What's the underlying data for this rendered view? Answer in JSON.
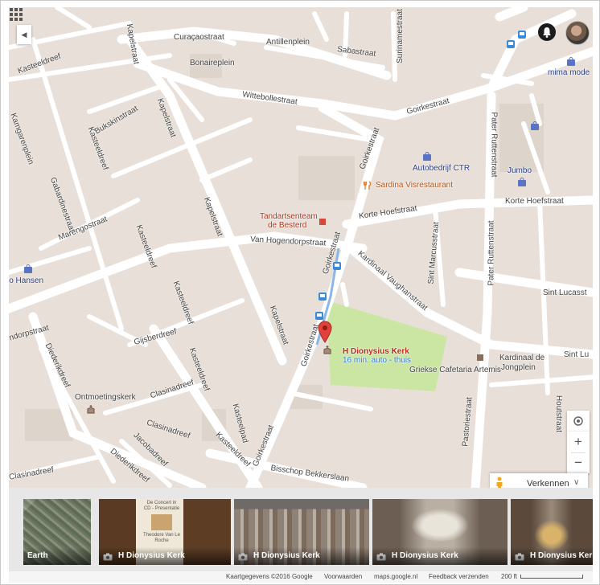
{
  "colors": {
    "map_bg": "#e8e0d8",
    "road": "#ffffff",
    "park": "#cbe6a3",
    "pin": "#e2403a",
    "transit": "#3b8ad8",
    "shop": "#3350a0"
  },
  "streets": [
    {
      "id": "curacaostraat",
      "text": "Curaçaostraat"
    },
    {
      "id": "antillenplein",
      "text": "Antillenplein"
    },
    {
      "id": "sabastraat",
      "text": "Sabastraat"
    },
    {
      "id": "surinamestraat",
      "text": "Surinamestraat"
    },
    {
      "id": "bonaireplein",
      "text": "Bonaireplein"
    },
    {
      "id": "kapelstraat-top",
      "text": "Kapelstraat"
    },
    {
      "id": "kasteeldreef-top",
      "text": "Kasteeldreef"
    },
    {
      "id": "wittebollestraat",
      "text": "Wittebollestraat"
    },
    {
      "id": "goirkestraat-ne",
      "text": "Goirkestraat"
    },
    {
      "id": "bukskinstraat",
      "text": "Bukskinstraat"
    },
    {
      "id": "kapelstraat-mid",
      "text": "Kapelstraat"
    },
    {
      "id": "kamgarenplein",
      "text": "Kamgarenplein"
    },
    {
      "id": "kasteeldreef-2",
      "text": "Kasteeldreef"
    },
    {
      "id": "gabardinestraat",
      "text": "Gabardinestraat"
    },
    {
      "id": "pater-ruttenstraat-top",
      "text": "Pater Ruttenstraat"
    },
    {
      "id": "goirkestraat-mid",
      "text": "Goirkestraat"
    },
    {
      "id": "kapelstraat-3",
      "text": "Kapelstraat"
    },
    {
      "id": "korte-hoefstraat-1",
      "text": "Korte Hoefstraat"
    },
    {
      "id": "korte-hoefstraat-2",
      "text": "Korte Hoefstraat"
    },
    {
      "id": "marengostraat",
      "text": "Marengostraat"
    },
    {
      "id": "kasteeldreef-3",
      "text": "Kasteeldreef"
    },
    {
      "id": "van-hogendorpstraat",
      "text": "Van Hogendorpstraat"
    },
    {
      "id": "goirkestraat-3",
      "text": "Goirkestraat"
    },
    {
      "id": "sint-marcusstraat",
      "text": "Sint Marcusstraat"
    },
    {
      "id": "pater-ruttenstraat-2",
      "text": "Pater Ruttenstraat"
    },
    {
      "id": "kardinaal-vaughanstraat",
      "text": "Kardinaal Vaughanstraat"
    },
    {
      "id": "sint-lucasstraat",
      "text": "Sint Lucasst"
    },
    {
      "id": "kasteeldreef-4",
      "text": "Kasteeldreef"
    },
    {
      "id": "kapelstraat-4",
      "text": "Kapelstraat"
    },
    {
      "id": "ndorpstraat",
      "text": "ndorpstraat"
    },
    {
      "id": "gijsberdreef",
      "text": "Gijsberdreef"
    },
    {
      "id": "diederikdreef-1",
      "text": "Diederikdreef"
    },
    {
      "id": "goirkestraat-4",
      "text": "Goirkestraat"
    },
    {
      "id": "kardinaal-de-jongplein-1",
      "text": "Kardinaal de"
    },
    {
      "id": "kardinaal-de-jongplein-2",
      "text": "Jongplein"
    },
    {
      "id": "sint-lu-2",
      "text": "Sint Lu"
    },
    {
      "id": "clasinadreef-1",
      "text": "Clasinadreef"
    },
    {
      "id": "kasteeldreef-5",
      "text": "Kasteeldreef"
    },
    {
      "id": "clasinadreef-2",
      "text": "Clasinadreef"
    },
    {
      "id": "kasteelpad",
      "text": "Kasteelpad"
    },
    {
      "id": "jacobadreef",
      "text": "Jacobadreef"
    },
    {
      "id": "kasteeldreef-6",
      "text": "Kasteeldreef"
    },
    {
      "id": "clasinadreef-3",
      "text": "Clasinadreef"
    },
    {
      "id": "diederikdreef-2",
      "text": "Diederikdreef"
    },
    {
      "id": "goirkestraat-5",
      "text": "Goirkestraat"
    },
    {
      "id": "bisschop-bekkerslaan",
      "text": "Bisschop Bekkerslaan"
    },
    {
      "id": "pastoriestraat",
      "text": "Pastoriestraat"
    },
    {
      "id": "houtstraat",
      "text": "Houtstraat"
    }
  ],
  "pois": [
    {
      "id": "mima-mode",
      "text": "mima mode",
      "kind": "shop"
    },
    {
      "id": "autobedrijf-ctr",
      "text": "Autobedrijf CTR",
      "kind": "shop"
    },
    {
      "id": "jumbo",
      "text": "Jumbo",
      "kind": "shop"
    },
    {
      "id": "sardina",
      "text": "Sardina Visrestaurant",
      "kind": "food"
    },
    {
      "id": "tandarts-1",
      "text": "Tandartsenteam",
      "kind": "dent"
    },
    {
      "id": "tandarts-2",
      "text": "de Besterd",
      "kind": "dent"
    },
    {
      "id": "hansen",
      "text": "lo Hansen",
      "kind": "shop"
    },
    {
      "id": "cafetaria",
      "text": "Griekse Cafetaria Artemis",
      "kind": "gen"
    },
    {
      "id": "ontmoetingskerk",
      "text": "Ontmoetingskerk",
      "kind": "gen"
    }
  ],
  "pin": {
    "title": "H Dionysius Kerk",
    "subtitle": "16 min. auto - thuis"
  },
  "controls": {
    "explore_label": "Verkennen"
  },
  "strip": [
    {
      "caption": "Earth",
      "type": "earth"
    },
    {
      "caption": "H Dionysius Kerk",
      "type": "photo-cd"
    },
    {
      "caption": "H Dionysius Kerk",
      "type": "photo-interior"
    },
    {
      "caption": "H Dionysius Kerk",
      "type": "photo-nave"
    },
    {
      "caption": "H Dionysius Kerk",
      "type": "photo-altar"
    }
  ],
  "cd_cover": {
    "line1": "De Concert in",
    "line2": "CD - Presentatie",
    "line3": "Theodore Van Le Roche"
  },
  "footer": {
    "mapdata": "Kaartgegevens ©2016 Google",
    "terms": "Voorwaarden",
    "site": "maps.google.nl",
    "feedback": "Feedback verzenden",
    "scale": "200 ft"
  }
}
